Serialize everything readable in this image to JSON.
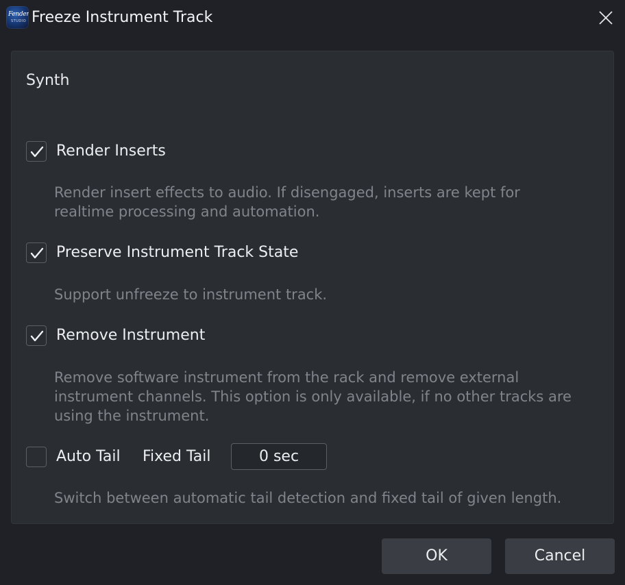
{
  "window": {
    "title": "Freeze Instrument Track",
    "app_icon": {
      "name": "fender-studio-app-icon",
      "text": "Fender",
      "subtext": "STUDIO"
    }
  },
  "panel": {
    "section_title": "Synth",
    "options": [
      {
        "label": "Render Inserts",
        "checked": true,
        "description": [
          "Render insert effects to audio. If disengaged, inserts are kept for",
          "realtime processing and automation."
        ]
      },
      {
        "label": "Preserve Instrument Track State",
        "checked": true,
        "description": [
          "Support unfreeze to instrument track."
        ]
      },
      {
        "label": "Remove Instrument",
        "checked": true,
        "description": [
          "Remove software instrument from the rack and remove external",
          "instrument channels. This option is only available, if no other tracks are",
          "using the instrument."
        ]
      },
      {
        "label": "Auto Tail",
        "checked": false,
        "description": [
          "Switch between automatic tail detection and fixed tail of given length."
        ]
      }
    ],
    "fixed_tail": {
      "label": "Fixed Tail",
      "value": "0 sec"
    }
  },
  "buttons": {
    "ok": "OK",
    "cancel": "Cancel"
  },
  "colors": {
    "background": "#1f2126",
    "panel": "#2a2d32",
    "button": "#3a3d43",
    "description_text": "#80848b"
  }
}
